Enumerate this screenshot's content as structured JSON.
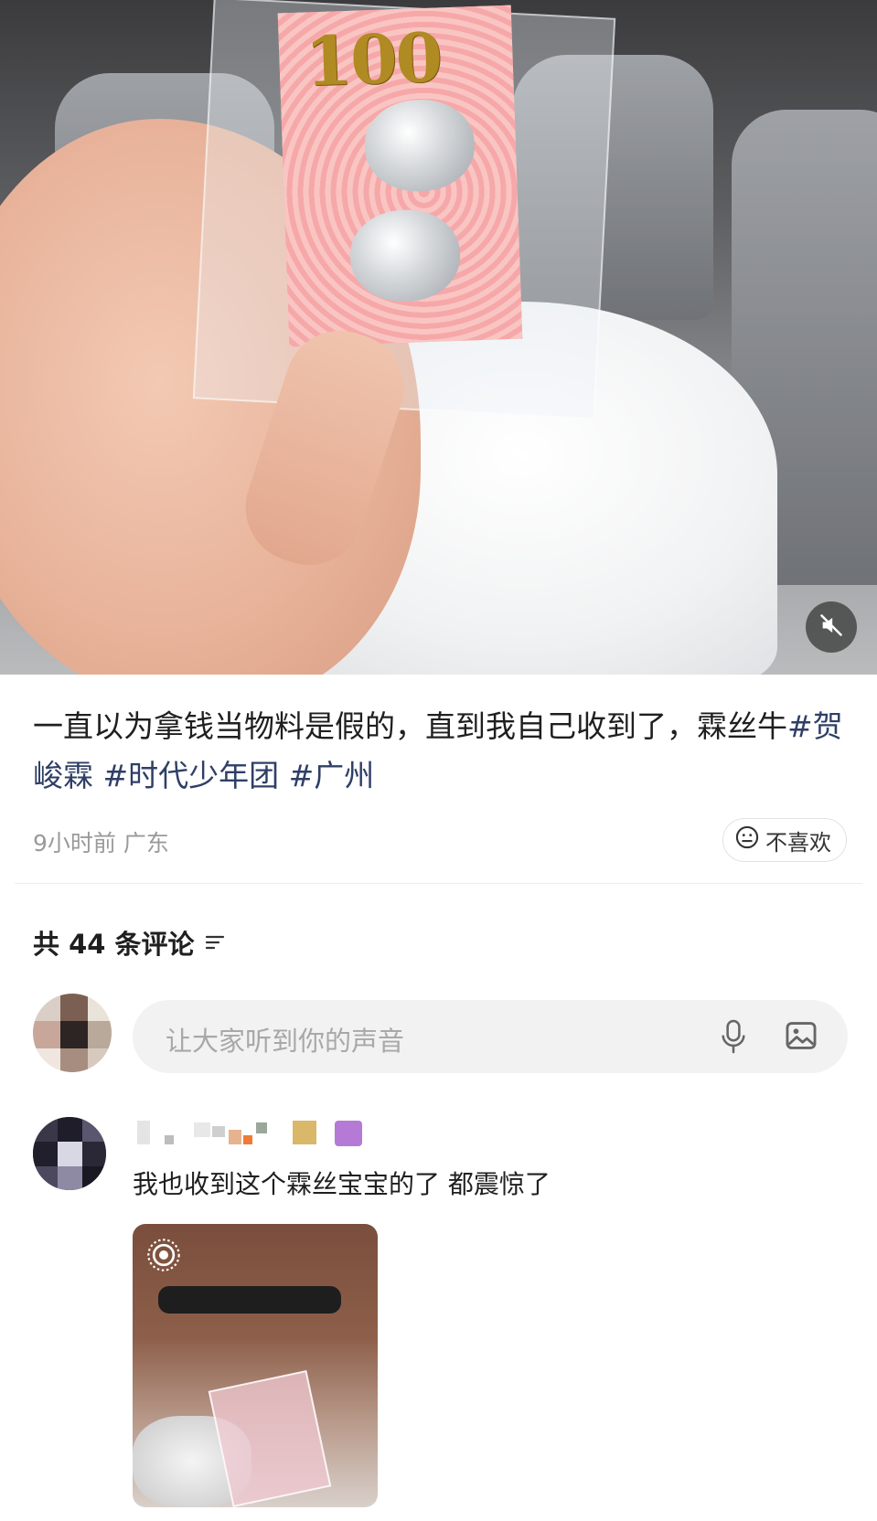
{
  "post": {
    "image": {
      "banknote_value": "100"
    },
    "text": "一直以为拿钱当物料是假的，直到我自己收到了，霖丝牛",
    "hashtags": [
      "#贺峻霖",
      "#时代少年团",
      "#广州"
    ],
    "time": "9小时前",
    "location": "广东",
    "dislike_label": "不喜欢"
  },
  "comments": {
    "header": "共 44 条评论",
    "input_placeholder": "让大家听到你的声音",
    "replies": [
      {
        "text": "我也收到这个霖丝宝宝的了 都震惊了"
      }
    ]
  },
  "colors": {
    "hashtag": "#2f3f66",
    "meta_gray": "#9a9a9a",
    "input_bg": "#f2f2f2"
  },
  "icons": [
    "mute-icon",
    "dislike-face-icon",
    "sort-icon",
    "microphone-icon",
    "image-icon",
    "live-photo-icon"
  ]
}
